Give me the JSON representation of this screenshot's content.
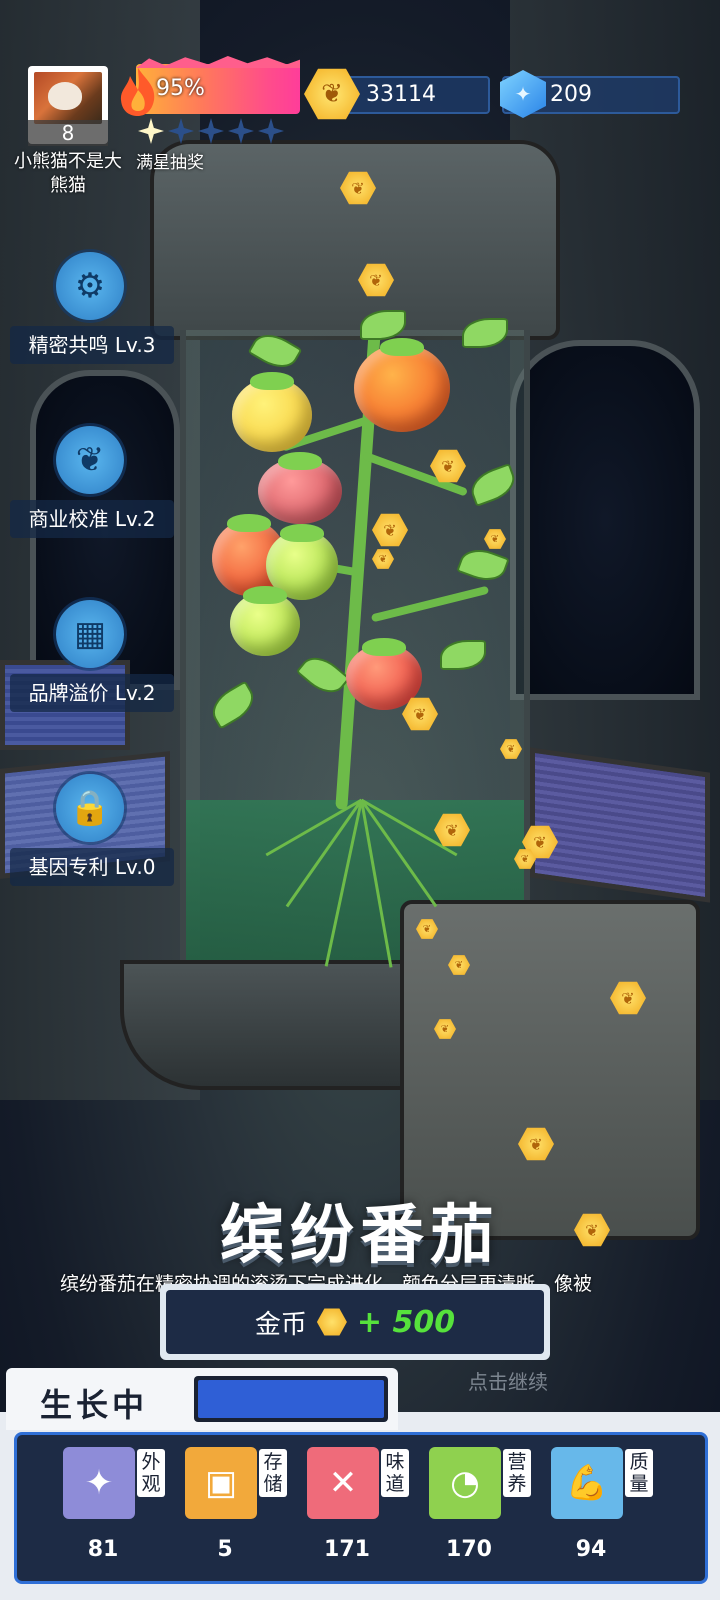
{
  "player": {
    "level": "8",
    "name": "小熊猫不是大熊猫"
  },
  "heat": {
    "percent_text": "95%",
    "level": 0.95,
    "stars_filled": 1,
    "stars_total": 5,
    "lottery_label": "满星抽奖"
  },
  "resources": {
    "gold": "33114",
    "gems": "209"
  },
  "skills": [
    {
      "label": "精密共鸣 Lv.3",
      "icon": "gear-sprout-icon"
    },
    {
      "label": "商业校准 Lv.2",
      "icon": "leaf-scan-icon"
    },
    {
      "label": "品牌溢价 Lv.2",
      "icon": "store-icon"
    },
    {
      "label": "基因专利 Lv.0",
      "icon": "lock-icon"
    }
  ],
  "crop": {
    "name": "缤纷番茄",
    "description": "缤纷番茄在精密协调的滚烫下完成进化，颜色分层更清晰，像被"
  },
  "reward": {
    "label": "金币",
    "amount": "+ 500"
  },
  "continue_hint": "点击继续",
  "growth": {
    "status": "生长中",
    "progress": 1.0
  },
  "attributes": [
    {
      "name": "外观",
      "value": "81",
      "icon": "sparkle-icon",
      "color": "#8e8cd8"
    },
    {
      "name": "存储",
      "value": "5",
      "icon": "box-icon",
      "color": "#f2a93b"
    },
    {
      "name": "味道",
      "value": "171",
      "icon": "fork-knife-icon",
      "color": "#ef6b7a"
    },
    {
      "name": "营养",
      "value": "170",
      "icon": "lime-icon",
      "color": "#8fd14f"
    },
    {
      "name": "质量",
      "value": "94",
      "icon": "muscle-icon",
      "color": "#67b8ea"
    }
  ]
}
